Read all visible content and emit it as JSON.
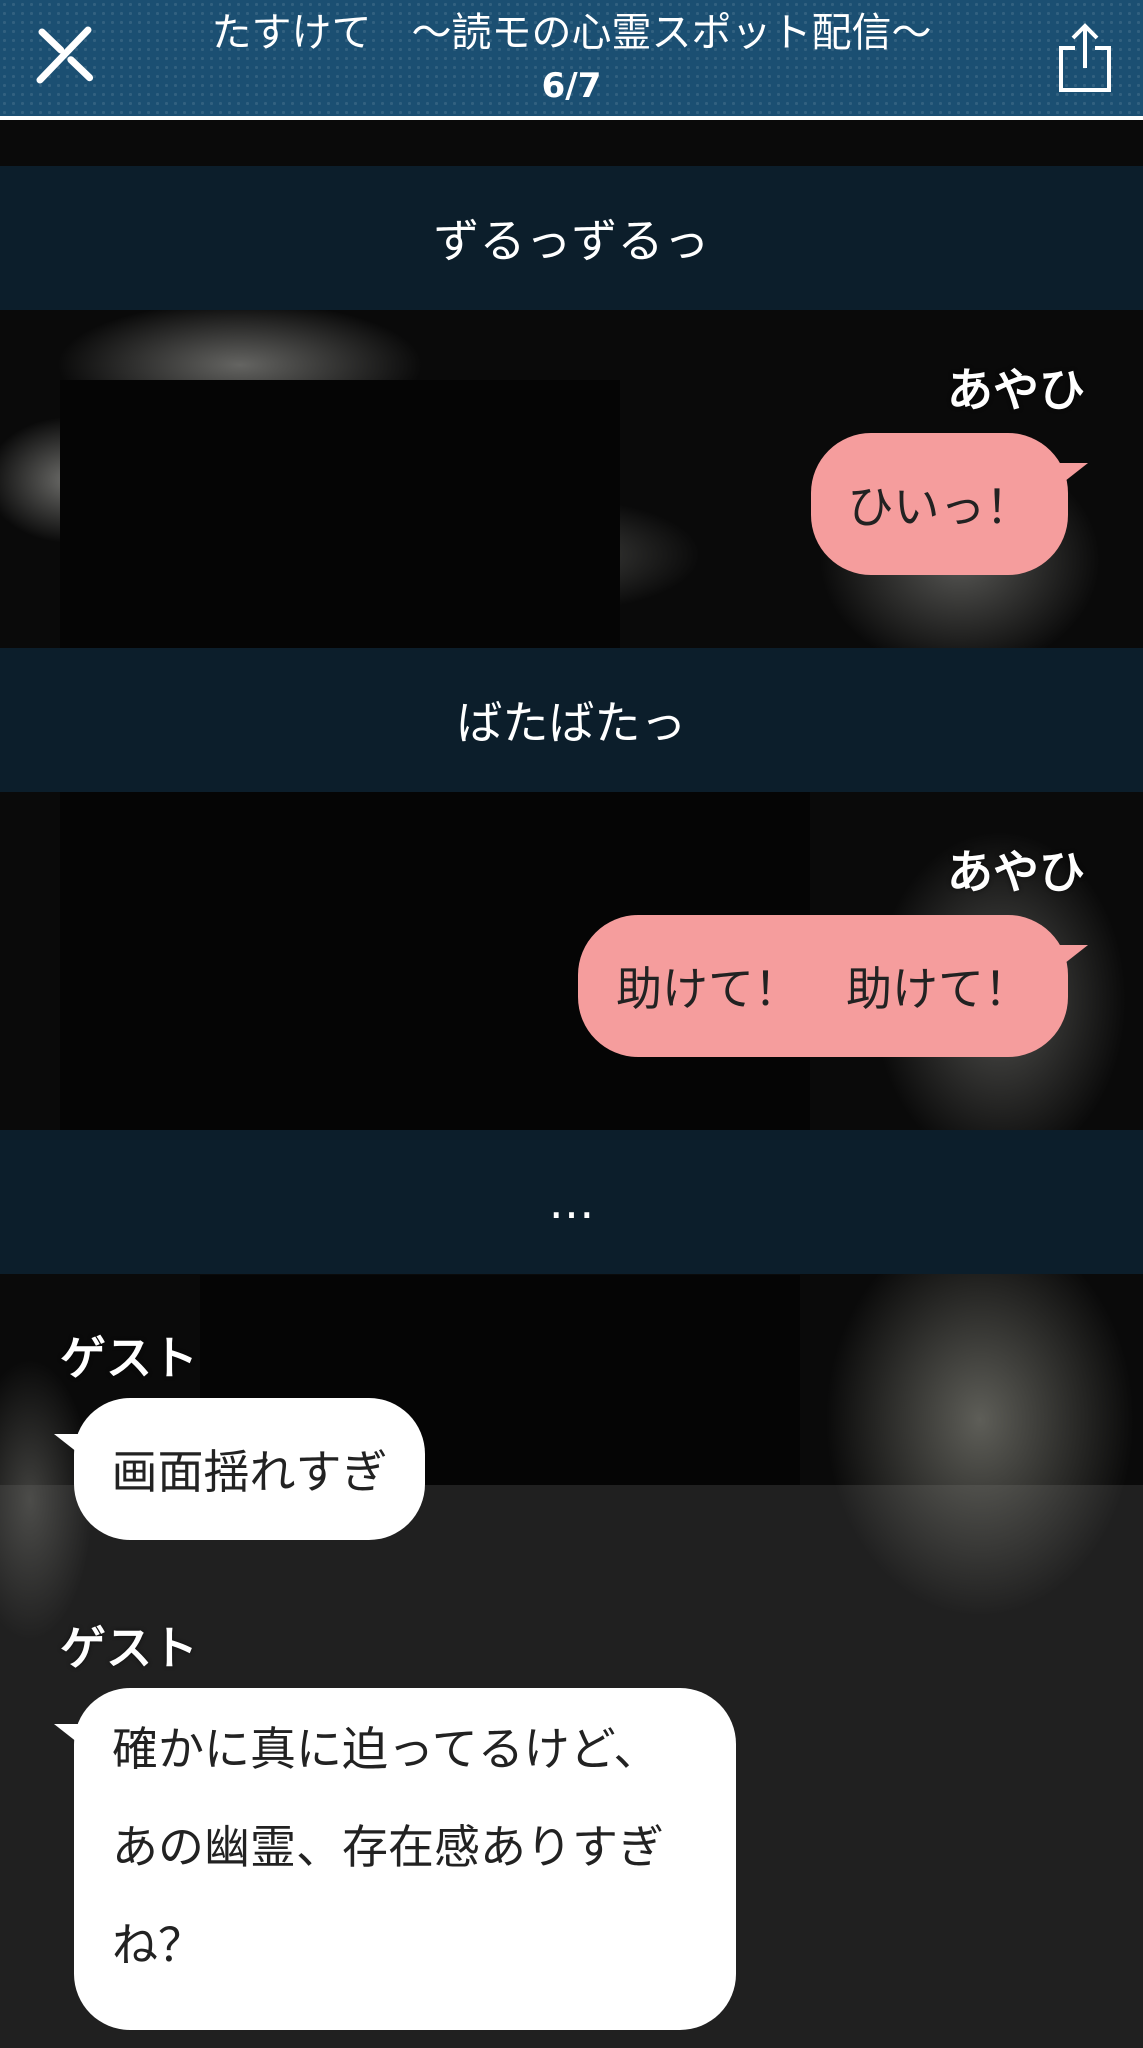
{
  "header": {
    "title": "たすけて　～読モの心霊スポット配信～",
    "page_indicator": "6/7",
    "close_icon": "close-icon",
    "share_icon": "share-icon",
    "color": "#1b4f72"
  },
  "story": {
    "narration_1": "ずるっずるっ",
    "narration_2": "ばたばたっ",
    "narration_3": "…",
    "message_1": {
      "speaker": "あやひ",
      "text": "ひいっ！",
      "color": "#f59d9d"
    },
    "message_2": {
      "speaker": "あやひ",
      "text": "助けて！　助けて！",
      "color": "#f59d9d"
    },
    "message_3": {
      "speaker": "ゲスト",
      "text": "画面揺れすぎ",
      "color": "#ffffff"
    },
    "message_4": {
      "speaker": "ゲスト",
      "lines": [
        "確かに真に迫ってるけど、",
        "あの幽霊、存在感ありすぎ",
        "ね？"
      ],
      "color": "#ffffff"
    }
  }
}
